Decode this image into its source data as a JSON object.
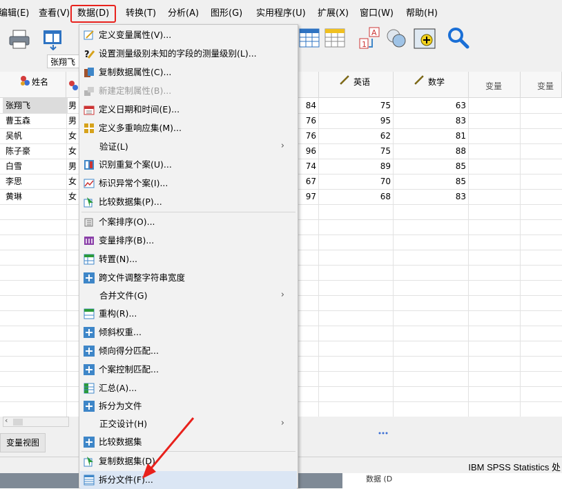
{
  "menubar": {
    "items": [
      {
        "label": "编辑(E)"
      },
      {
        "label": "查看(V)"
      },
      {
        "label": "数据(D)"
      },
      {
        "label": "转换(T)"
      },
      {
        "label": "分析(A)"
      },
      {
        "label": "图形(G)"
      },
      {
        "label": "实用程序(U)"
      },
      {
        "label": "扩展(X)"
      },
      {
        "label": "窗口(W)"
      },
      {
        "label": "帮助(H)"
      }
    ],
    "active_index": 2
  },
  "toolbar": {
    "icons": [
      "print-icon",
      "recall-dialog-icon",
      "insert-cases-icon",
      "insert-variable-icon",
      "value-labels-icon",
      "use-sets-icon",
      "select-cases-icon",
      "find-icon"
    ]
  },
  "case_cell": {
    "value": "张翔飞"
  },
  "grid": {
    "columns": [
      {
        "label": "姓名",
        "icon": "nominal-icon"
      },
      {
        "label": "",
        "icon": "nominal-icon"
      },
      {
        "label": "",
        "icon": ""
      },
      {
        "label": "英语",
        "icon": "scale-icon"
      },
      {
        "label": "数学",
        "icon": "scale-icon"
      },
      {
        "label": "变量",
        "icon": ""
      },
      {
        "label": "变量",
        "icon": ""
      }
    ],
    "rows": [
      {
        "name": "张翔飞",
        "gender": "男",
        "c3": "84",
        "english": "75",
        "math": "63"
      },
      {
        "name": "曹玉森",
        "gender": "男",
        "c3": "76",
        "english": "95",
        "math": "83"
      },
      {
        "name": "吴帆",
        "gender": "女",
        "c3": "76",
        "english": "62",
        "math": "81"
      },
      {
        "name": "陈子豪",
        "gender": "女",
        "c3": "96",
        "english": "75",
        "math": "88"
      },
      {
        "name": "白雪",
        "gender": "男",
        "c3": "74",
        "english": "89",
        "math": "85"
      },
      {
        "name": "李思",
        "gender": "女",
        "c3": "67",
        "english": "70",
        "math": "85"
      },
      {
        "name": "黄琳",
        "gender": "女",
        "c3": "97",
        "english": "68",
        "math": "83"
      }
    ]
  },
  "tabs": {
    "variable_view": "变量视图"
  },
  "status": {
    "text": "IBM SPSS Statistics 处"
  },
  "taskbar": {
    "text": "数据 (D"
  },
  "dropdown": {
    "items": [
      {
        "label": "定义变量属性(V)...",
        "icon": "define-properties-icon"
      },
      {
        "label": "设置测量级别未知的字段的测量级别(L)...",
        "icon": "set-measurement-icon"
      },
      {
        "label": "复制数据属性(C)...",
        "icon": "copy-properties-icon"
      },
      {
        "label": "新建定制属性(B)...",
        "icon": "custom-attribute-icon",
        "disabled": true
      },
      {
        "label": "定义日期和时间(E)...",
        "icon": "date-time-icon"
      },
      {
        "label": "定义多重响应集(M)...",
        "icon": "multiple-response-icon"
      },
      {
        "label": "验证(L)",
        "icon": "",
        "submenu": true
      },
      {
        "label": "识别重复个案(U)...",
        "icon": "duplicate-cases-icon"
      },
      {
        "label": "标识异常个案(I)...",
        "icon": "unusual-cases-icon"
      },
      {
        "label": "比较数据集(P)...",
        "icon": "compare-datasets-icon"
      },
      {
        "label": "个案排序(O)...",
        "icon": "sort-cases-icon"
      },
      {
        "label": "变量排序(B)...",
        "icon": "sort-variables-icon"
      },
      {
        "label": "转置(N)...",
        "icon": "transpose-icon"
      },
      {
        "label": "跨文件调整字符串宽度",
        "icon": "plus-icon"
      },
      {
        "label": "合并文件(G)",
        "icon": "",
        "submenu": true
      },
      {
        "label": "重构(R)...",
        "icon": "restructure-icon"
      },
      {
        "label": "倾斜权重...",
        "icon": "plus-icon"
      },
      {
        "label": "倾向得分匹配...",
        "icon": "plus-icon"
      },
      {
        "label": "个案控制匹配...",
        "icon": "plus-icon"
      },
      {
        "label": "汇总(A)...",
        "icon": "aggregate-icon"
      },
      {
        "label": "拆分为文件",
        "icon": "plus-icon"
      },
      {
        "label": "正交设计(H)",
        "icon": "",
        "submenu": true
      },
      {
        "label": "比较数据集",
        "icon": "plus-icon"
      },
      {
        "label": "复制数据集(D)",
        "icon": "copy-dataset-icon"
      },
      {
        "label": "拆分文件(F)...",
        "icon": "split-file-icon",
        "highlight": true
      }
    ],
    "arrow_glyph": "›"
  },
  "annotation": {
    "arrow_color": "#e8211c"
  }
}
